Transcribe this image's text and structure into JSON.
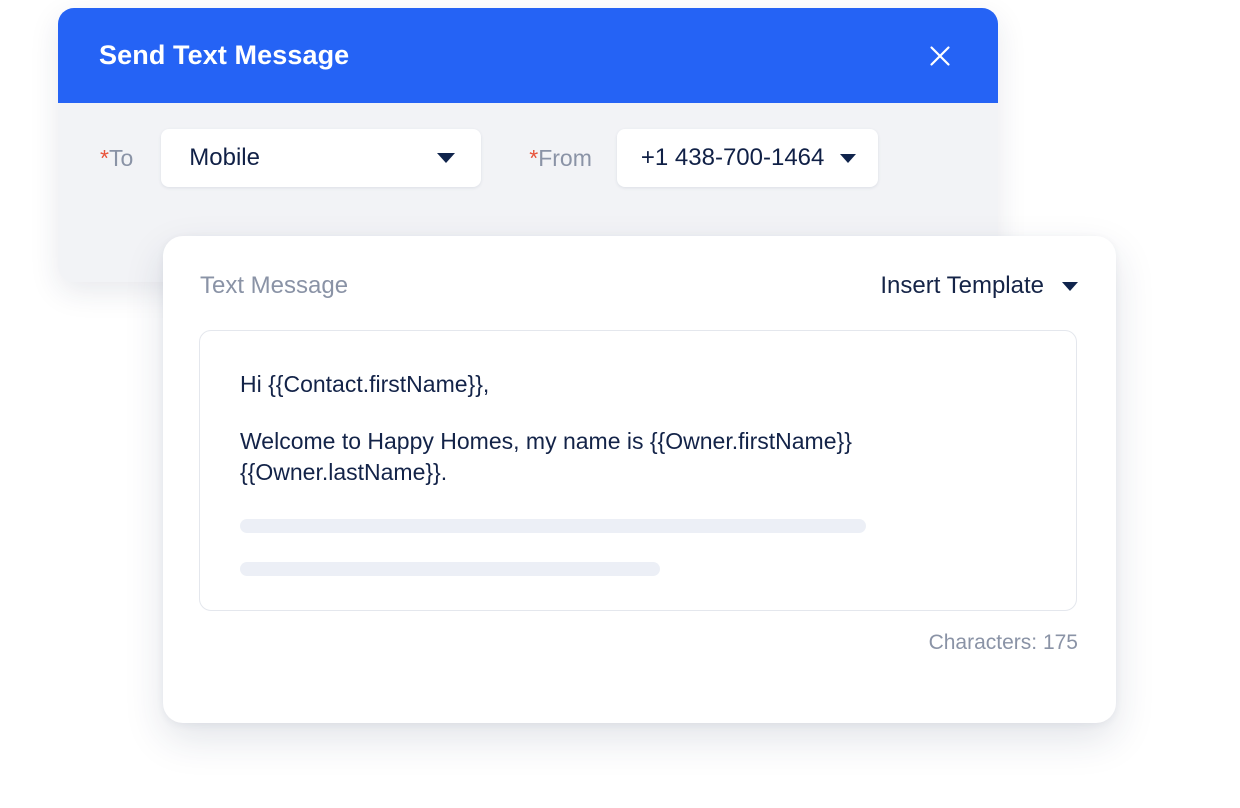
{
  "dialog": {
    "title": "Send Text Message",
    "close_icon": "close-icon",
    "fields": {
      "to": {
        "required_mark": "*",
        "label": "To",
        "value": "Mobile",
        "caret_icon": "chevron-down-icon"
      },
      "from": {
        "required_mark": "*",
        "label": "From",
        "value": "+1 438-700-1464",
        "caret_icon": "chevron-down-icon"
      }
    }
  },
  "message_panel": {
    "label": "Text Message",
    "insert_template": {
      "label": "Insert Template",
      "caret_icon": "chevron-down-icon"
    },
    "body": {
      "line1": "Hi {{Contact.firstName}},",
      "line2": "Welcome to Happy Homes, my name is {{Owner.firstName}} {{Owner.lastName}}."
    },
    "character_count": "Characters: 175"
  },
  "colors": {
    "header_blue": "#2563f5",
    "dialog_body": "#f2f3f6",
    "required_red": "#e8533a",
    "label_gray": "#8a93a6",
    "text_navy": "#132348",
    "skeleton": "#eceff6"
  }
}
